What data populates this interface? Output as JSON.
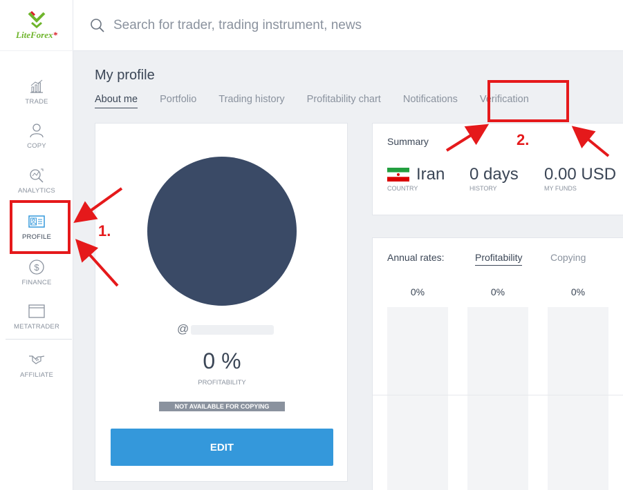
{
  "logo": {
    "brand_main": "LiteForex",
    "registered_mark": "*"
  },
  "header": {
    "search_placeholder": "Search for trader, trading instrument, news"
  },
  "sidebar": {
    "items": [
      {
        "label": "TRADE",
        "icon": "chart-icon"
      },
      {
        "label": "COPY",
        "icon": "user-icon"
      },
      {
        "label": "ANALYTICS",
        "icon": "analytics-icon"
      },
      {
        "label": "PROFILE",
        "icon": "id-card-icon",
        "active": true
      },
      {
        "label": "FINANCE",
        "icon": "dollar-coin-icon"
      },
      {
        "label": "METATRADER",
        "icon": "window-icon"
      },
      {
        "label": "AFFILIATE",
        "icon": "handshake-icon"
      }
    ]
  },
  "page": {
    "title": "My profile",
    "tabs": [
      {
        "label": "About me",
        "active": true
      },
      {
        "label": "Portfolio"
      },
      {
        "label": "Trading history"
      },
      {
        "label": "Profitability chart"
      },
      {
        "label": "Notifications"
      },
      {
        "label": "Verification"
      }
    ]
  },
  "profile_card": {
    "username_prefix": "@",
    "profitability_value": "0 %",
    "profitability_label": "PROFITABILITY",
    "copying_badge": "NOT AVAILABLE FOR COPYING",
    "edit_label": "EDIT"
  },
  "summary": {
    "title": "Summary",
    "country_value": "Iran",
    "country_label": "COUNTRY",
    "history_value": "0 days",
    "history_label": "HISTORY",
    "funds_value": "0.00 USD",
    "funds_label": "MY FUNDS"
  },
  "rates": {
    "label": "Annual rates:",
    "tabs": [
      {
        "label": "Profitability",
        "active": true
      },
      {
        "label": "Copying"
      }
    ],
    "values": [
      "0%",
      "0%",
      "0%"
    ]
  },
  "annotations": {
    "step1": "1.",
    "step2": "2."
  },
  "colors": {
    "accent": "#3498db",
    "avatar": "#3a4a66",
    "annotation": "#e5191b",
    "brand_green": "#6fb52c"
  }
}
